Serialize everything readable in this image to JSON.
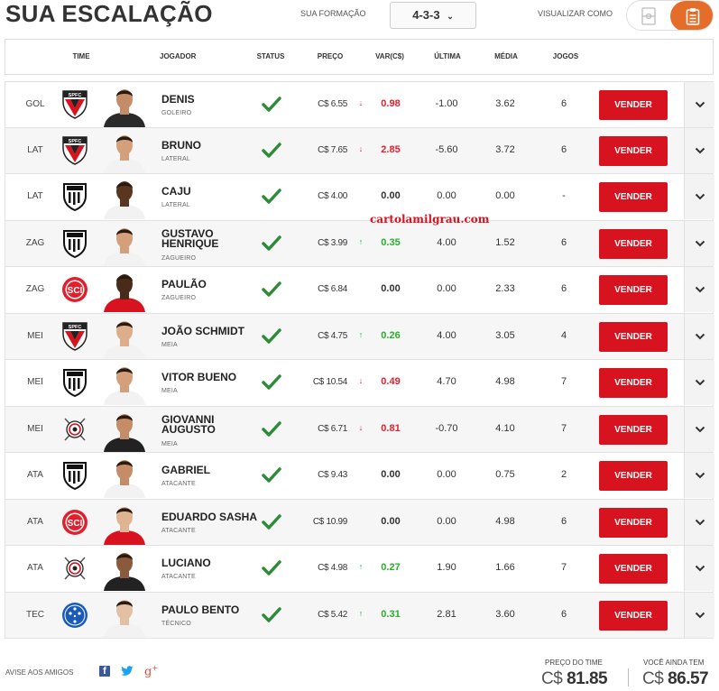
{
  "header": {
    "title": "SUA ESCALAÇÃO",
    "formation_label": "SUA FORMAÇÃO",
    "formation_value": "4-3-3",
    "view_label": "VISUALIZAR COMO"
  },
  "columns": {
    "time": "TIME",
    "jogador": "JOGADOR",
    "status": "STATUS",
    "preco": "PREÇO",
    "var": "VAR(C$)",
    "ultima": "ÚLTIMA",
    "media": "MÉDIA",
    "jogos": "JOGOS"
  },
  "sell_label": "VENDER",
  "watermark": "cartolamilgrau.com",
  "players": [
    {
      "pos": "GOL",
      "club": "spfc",
      "name": "DENIS",
      "role": "GOLEIRO",
      "price": "C$ 6.55",
      "dir": "down",
      "var": "0.98",
      "ultima": "-1.00",
      "media": "3.62",
      "jogos": "6",
      "skin": "#c58c68",
      "shirt": "#2a2a2a"
    },
    {
      "pos": "LAT",
      "club": "spfc",
      "name": "BRUNO",
      "role": "LATERAL",
      "price": "C$ 7.65",
      "dir": "down",
      "var": "2.85",
      "ultima": "-5.60",
      "media": "3.72",
      "jogos": "6",
      "skin": "#d4a07c",
      "shirt": "#f2f2f2"
    },
    {
      "pos": "LAT",
      "club": "santos",
      "name": "CAJU",
      "role": "LATERAL",
      "price": "C$ 4.00",
      "dir": "none",
      "var": "0.00",
      "ultima": "0.00",
      "media": "0.00",
      "jogos": "-",
      "skin": "#5a3621",
      "shirt": "#f2f2f2"
    },
    {
      "pos": "ZAG",
      "club": "santos",
      "name": "GUSTAVO HENRIQUE",
      "role": "ZAGUEIRO",
      "price": "C$ 3.99",
      "dir": "up",
      "var": "0.35",
      "ultima": "4.00",
      "media": "1.52",
      "jogos": "6",
      "skin": "#d4a07c",
      "shirt": "#f2f2f2"
    },
    {
      "pos": "ZAG",
      "club": "inter",
      "name": "PAULÃO",
      "role": "ZAGUEIRO",
      "price": "C$ 6.84",
      "dir": "none",
      "var": "0.00",
      "ultima": "0.00",
      "media": "2.33",
      "jogos": "6",
      "skin": "#4a2a18",
      "shirt": "#d7131f"
    },
    {
      "pos": "MEI",
      "club": "spfc",
      "name": "JOÃO SCHMIDT",
      "role": "MEIA",
      "price": "C$ 4.75",
      "dir": "up",
      "var": "0.26",
      "ultima": "4.00",
      "media": "3.05",
      "jogos": "4",
      "skin": "#dcae8c",
      "shirt": "#f2f2f2"
    },
    {
      "pos": "MEI",
      "club": "santos",
      "name": "VITOR BUENO",
      "role": "MEIA",
      "price": "C$ 10.54",
      "dir": "down",
      "var": "0.49",
      "ultima": "4.70",
      "media": "4.98",
      "jogos": "7",
      "skin": "#d4a07c",
      "shirt": "#f2f2f2"
    },
    {
      "pos": "MEI",
      "club": "corinthians",
      "name": "GIOVANNI AUGUSTO",
      "role": "MEIA",
      "price": "C$ 6.71",
      "dir": "down",
      "var": "0.81",
      "ultima": "-0.70",
      "media": "4.10",
      "jogos": "7",
      "skin": "#c58c68",
      "shirt": "#222222"
    },
    {
      "pos": "ATA",
      "club": "santos",
      "name": "GABRIEL",
      "role": "ATACANTE",
      "price": "C$ 9.43",
      "dir": "none",
      "var": "0.00",
      "ultima": "0.00",
      "media": "0.75",
      "jogos": "2",
      "skin": "#c58c68",
      "shirt": "#f2f2f2"
    },
    {
      "pos": "ATA",
      "club": "inter",
      "name": "EDUARDO SASHA",
      "role": "ATACANTE",
      "price": "C$ 10.99",
      "dir": "none",
      "var": "0.00",
      "ultima": "0.00",
      "media": "4.98",
      "jogos": "6",
      "skin": "#e0b493",
      "shirt": "#d7131f"
    },
    {
      "pos": "ATA",
      "club": "corinthians",
      "name": "LUCIANO",
      "role": "ATACANTE",
      "price": "C$ 4.98",
      "dir": "up",
      "var": "0.27",
      "ultima": "1.90",
      "media": "1.66",
      "jogos": "7",
      "skin": "#8a5a3c",
      "shirt": "#222222"
    },
    {
      "pos": "TEC",
      "club": "cruzeiro",
      "name": "PAULO BENTO",
      "role": "TÉCNICO",
      "price": "C$ 5.42",
      "dir": "up",
      "var": "0.31",
      "ultima": "2.81",
      "media": "3.60",
      "jogos": "6",
      "skin": "#e3bfa3",
      "shirt": "#f2f2f2"
    }
  ],
  "footer": {
    "share_label": "AVISE AOS AMIGOS",
    "team_price_label": "PREÇO DO TIME",
    "currency": "C$",
    "team_price_value": "81.85",
    "remaining_label": "VOCÊ AINDA TEM",
    "remaining_value": "86.57"
  },
  "colors": {
    "sell": "#d7131f",
    "up": "#27b02a",
    "down": "#e21f2b",
    "accent": "#e56d2a"
  }
}
